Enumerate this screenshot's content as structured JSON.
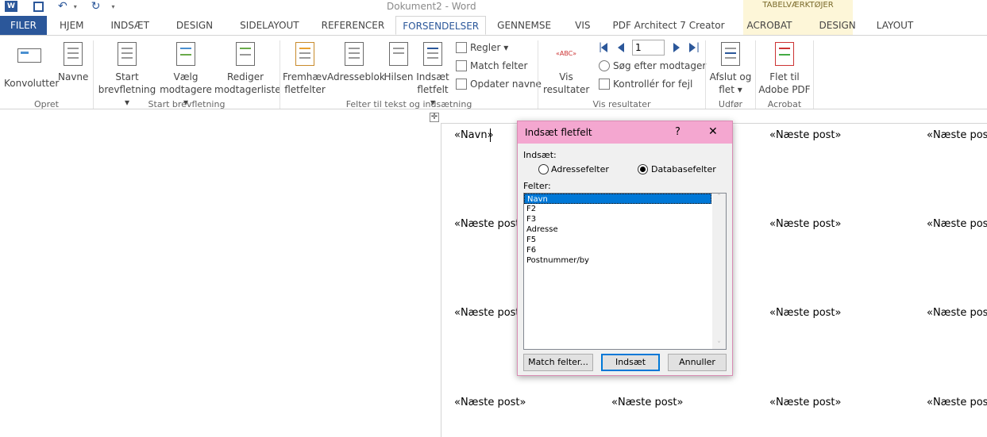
{
  "titlebar": {
    "doc_title": "Dokument2 - Word",
    "context_title": "TABELVÆRKTØJER"
  },
  "tabs": [
    "FILER",
    "HJEM",
    "INDSÆT",
    "DESIGN",
    "SIDELAYOUT",
    "REFERENCER",
    "FORSENDELSER",
    "GENNEMSE",
    "VIS",
    "PDF Architect 7 Creator",
    "ACROBAT",
    "DESIGN",
    "LAYOUT"
  ],
  "ribbon": {
    "konvolutter": "Konvolutter",
    "navne": "Navne",
    "start1": "Start",
    "start2": "brevfletning ▾",
    "vaelg1": "Vælg",
    "vaelg2": "modtagere ▾",
    "redig1": "Rediger",
    "redig2": "modtagerliste",
    "frem1": "Fremhæv",
    "frem2": "fletfelter",
    "adresseblok": "Adresseblok",
    "hilsen": "Hilsen",
    "inds1": "Indsæt",
    "inds2": "fletfelt ▾",
    "regler": "Regler ▾",
    "match": "Match felter",
    "opdater": "Opdater navne",
    "vis1": "Vis",
    "vis2": "resultater",
    "record": "1",
    "soeg": "Søg efter modtager",
    "kontroller": "Kontrollér for fejl",
    "afslut1": "Afslut og",
    "afslut2": "flet ▾",
    "flet1": "Flet til",
    "flet2": "Adobe PDF",
    "groups": {
      "opret": "Opret",
      "startbrev": "Start brevfletning",
      "felter": "Felter til tekst og indsætning",
      "visres": "Vis resultater",
      "udfor": "Udfør",
      "acrobat": "Acrobat"
    }
  },
  "document": {
    "navn_field": "«Navn»",
    "next": "«Næste post»"
  },
  "dialog": {
    "title": "Indsæt fletfelt",
    "help": "?",
    "close": "✕",
    "insert_label": "Indsæt:",
    "radio_address": "Adressefelter",
    "radio_db": "Databasefelter",
    "fields_label": "Felter:",
    "fields": [
      "Navn",
      "F2",
      "F3",
      "Adresse",
      "F5",
      "F6",
      "Postnummer/by"
    ],
    "btn_match": "Match felter...",
    "btn_insert": "Indsæt",
    "btn_cancel": "Annuller"
  }
}
